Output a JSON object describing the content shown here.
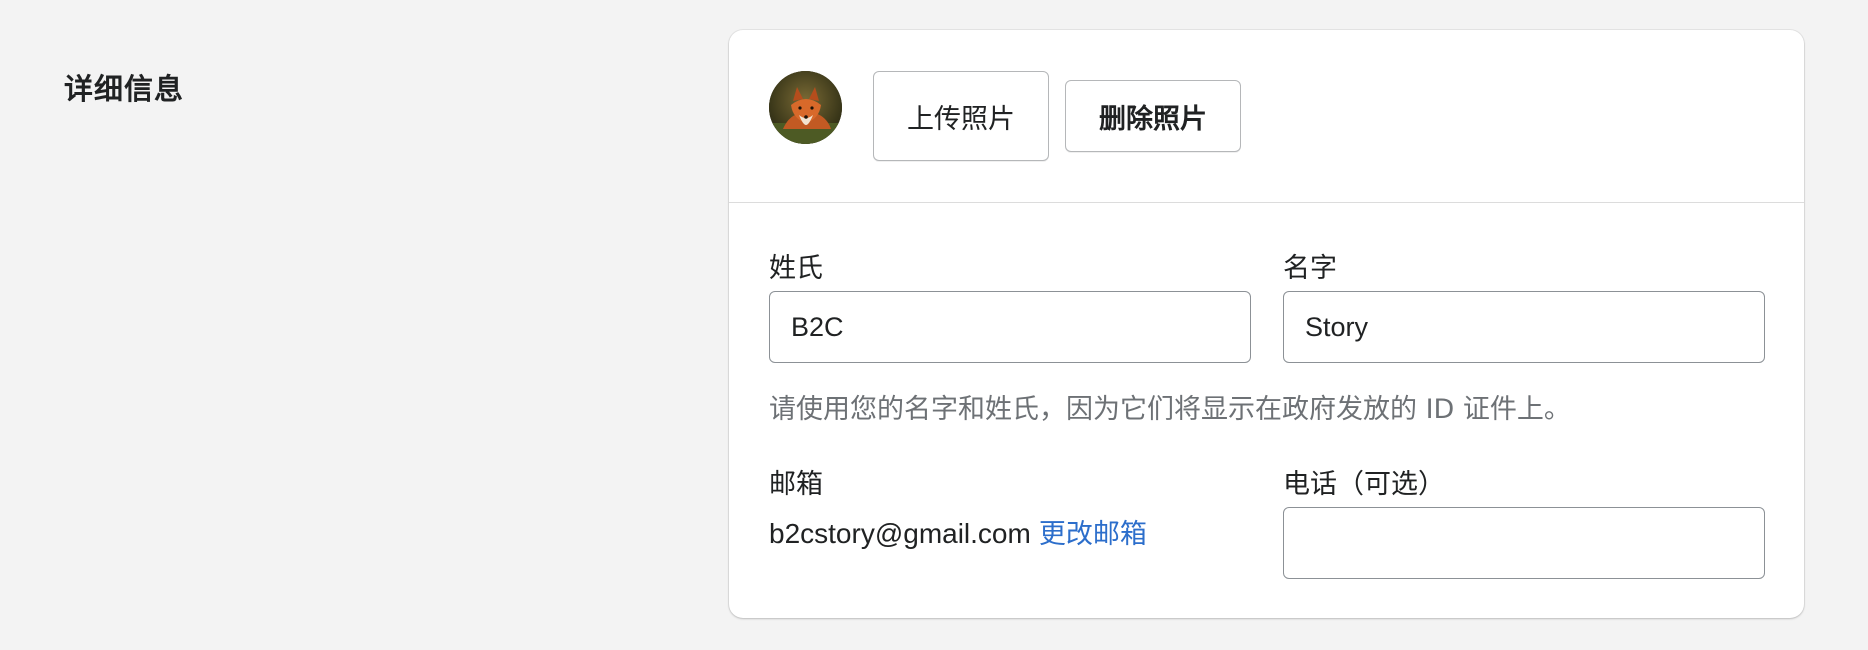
{
  "section": {
    "title": "详细信息"
  },
  "photo": {
    "avatar_alt": "fox-photo",
    "upload_label": "上传照片",
    "delete_label": "删除照片"
  },
  "form": {
    "last_name": {
      "label": "姓氏",
      "value": "B2C"
    },
    "first_name": {
      "label": "名字",
      "value": "Story"
    },
    "name_hint": "请使用您的名字和姓氏，因为它们将显示在政府发放的 ID 证件上。",
    "email": {
      "label": "邮箱",
      "value": "b2cstory@gmail.com",
      "change_link": "更改邮箱"
    },
    "phone": {
      "label": "电话（可选）",
      "value": ""
    }
  },
  "colors": {
    "link": "#2c6ecb",
    "page_background": "#f3f3f3",
    "hint_text": "#6d7175"
  }
}
